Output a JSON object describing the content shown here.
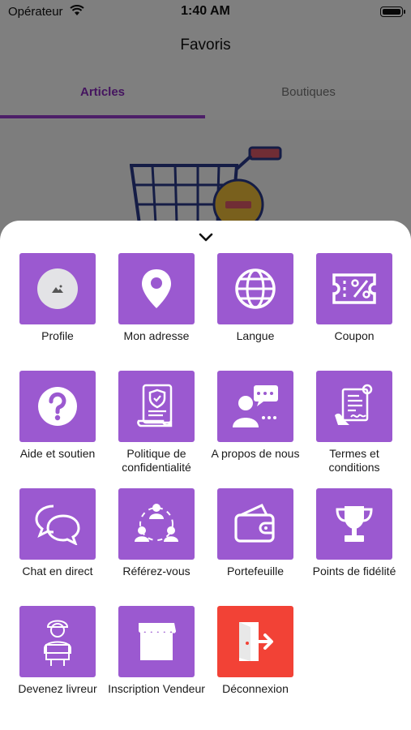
{
  "status_bar": {
    "carrier": "Opérateur",
    "time": "1:40 AM"
  },
  "header": {
    "title": "Favoris"
  },
  "tabs": [
    {
      "label": "Articles",
      "active": true
    },
    {
      "label": "Boutiques",
      "active": false
    }
  ],
  "menu": {
    "items": [
      {
        "label": "Profile",
        "icon": "avatar-placeholder-icon"
      },
      {
        "label": "Mon adresse",
        "icon": "location-pin-icon"
      },
      {
        "label": "Langue",
        "icon": "globe-icon"
      },
      {
        "label": "Coupon",
        "icon": "coupon-icon"
      },
      {
        "label": "Aide et soutien",
        "icon": "help-icon"
      },
      {
        "label": "Politique de confidentialité",
        "icon": "privacy-policy-icon"
      },
      {
        "label": "A propos de nous",
        "icon": "about-us-icon"
      },
      {
        "label": "Termes et conditions",
        "icon": "terms-icon"
      },
      {
        "label": "Chat en direct",
        "icon": "chat-icon"
      },
      {
        "label": "Référez-vous",
        "icon": "referral-icon"
      },
      {
        "label": "Portefeuille",
        "icon": "wallet-icon"
      },
      {
        "label": "Points de fidélité",
        "icon": "trophy-icon"
      },
      {
        "label": "Devenez livreur",
        "icon": "delivery-man-icon"
      },
      {
        "label": "Inscription Vendeur",
        "icon": "store-icon"
      },
      {
        "label": "Déconnexion",
        "icon": "logout-icon"
      }
    ]
  },
  "colors": {
    "accent": "#9b3fd1",
    "tile": "#9b59d0",
    "logout": "#f24236"
  }
}
